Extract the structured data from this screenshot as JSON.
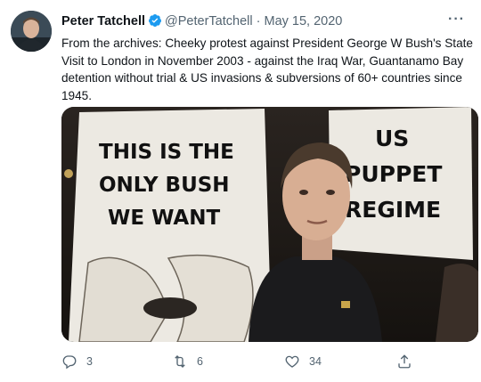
{
  "tweet": {
    "author_name": "Peter Tatchell",
    "handle": "@PeterTatchell",
    "separator": "·",
    "date": "May 15, 2020",
    "more_label": "···",
    "text": "From the archives: Cheeky protest against President George W Bush's State Visit to London in November 2003 - against the Iraq War, Guantanamo Bay detention without trial & US invasions & subversions of 60+ countries since 1945.",
    "photo": {
      "sign_left": [
        "THIS IS THE",
        "ONLY BUSH",
        "WE WANT"
      ],
      "sign_right": [
        "US",
        "PUPPET",
        "REGIME"
      ]
    },
    "actions": {
      "reply_count": "3",
      "retweet_count": "6",
      "like_count": "34"
    }
  },
  "colors": {
    "verified_blue": "#1d9bf0",
    "text_primary": "#0f1419",
    "text_secondary": "#536471",
    "sign_text": "#111111"
  },
  "icons": [
    "verified-badge-icon",
    "more-icon",
    "reply-icon",
    "retweet-icon",
    "like-icon",
    "share-icon"
  ]
}
